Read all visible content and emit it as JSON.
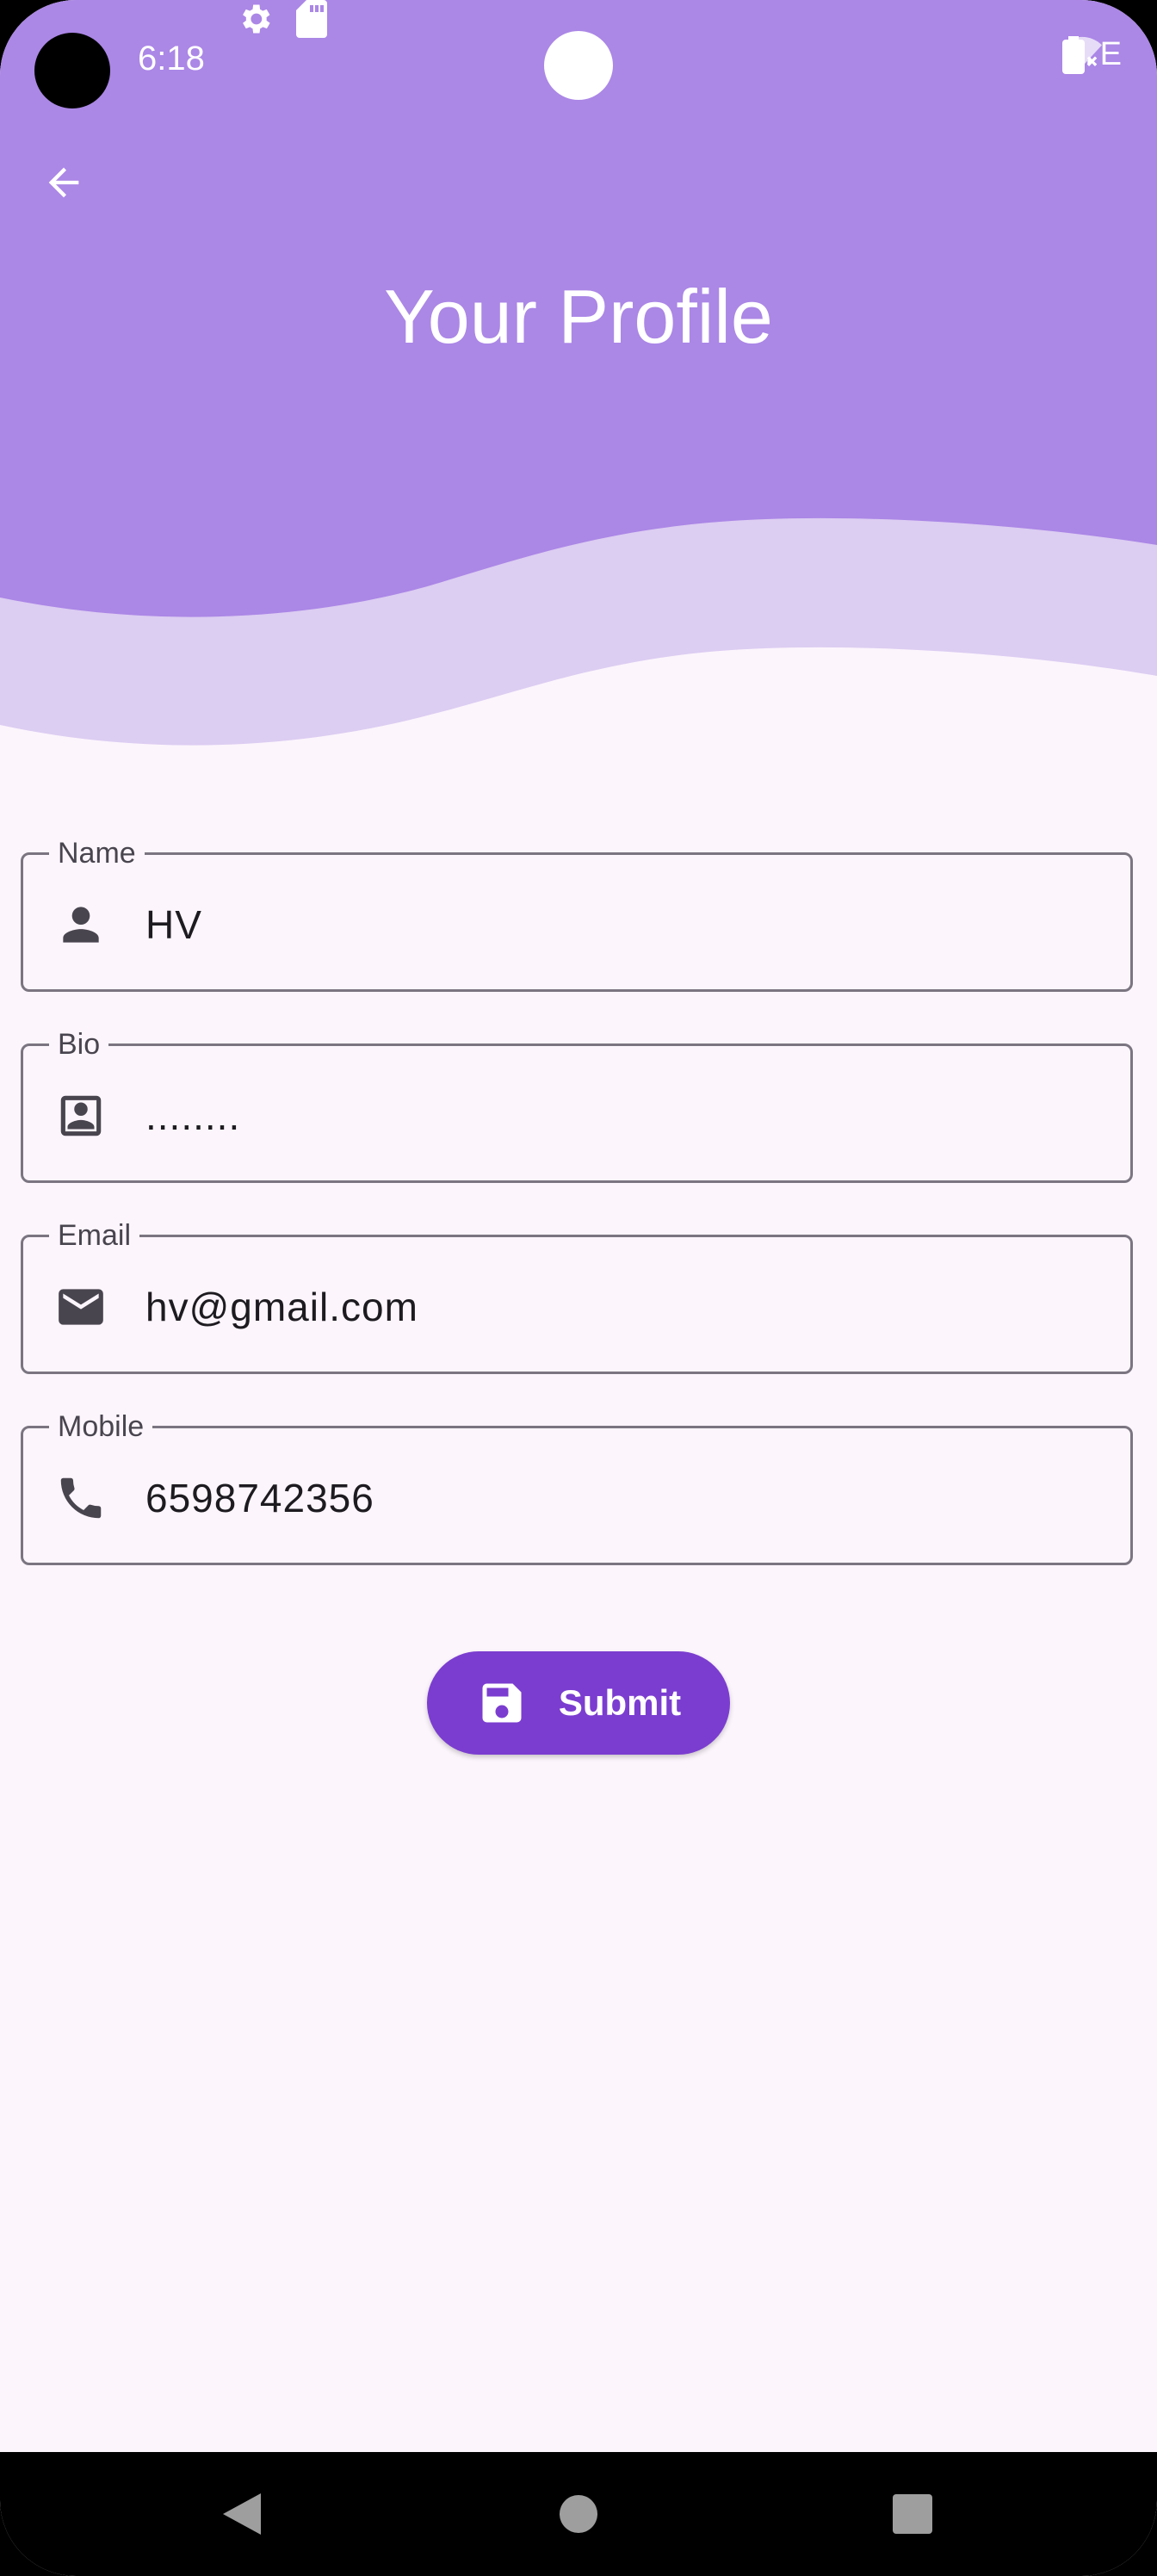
{
  "status_bar": {
    "time": "6:18",
    "network": "LTE"
  },
  "header": {
    "title": "Your Profile"
  },
  "form": {
    "fields": [
      {
        "label": "Name",
        "value": "HV",
        "icon": "person-icon"
      },
      {
        "label": "Bio",
        "value": "........",
        "icon": "contact-card-icon"
      },
      {
        "label": "Email",
        "value": "hv@gmail.com",
        "icon": "mail-icon"
      },
      {
        "label": "Mobile",
        "value": "6598742356",
        "icon": "phone-icon"
      }
    ],
    "submit_label": "Submit"
  },
  "colors": {
    "header": "#ab87e6",
    "wave": "#dccdf2",
    "background": "#fcf5fc",
    "accent": "#7b3dd0"
  }
}
